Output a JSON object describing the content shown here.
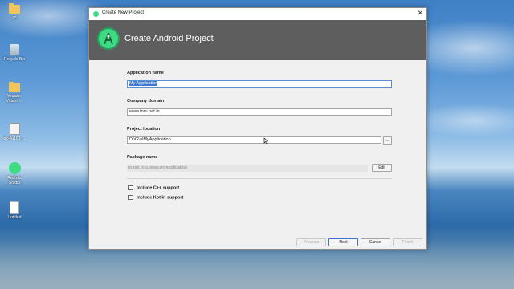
{
  "desktop_icons": [
    {
      "label": "git",
      "icon": "folder-icon"
    },
    {
      "label": "Recycle Bin",
      "icon": "recycle-bin-icon"
    },
    {
      "label": "Youtube Videos ...",
      "icon": "folder-icon"
    },
    {
      "label": "jdk-8u161_...",
      "icon": "java-installer-icon"
    },
    {
      "label": "Android Studio",
      "icon": "android-studio-icon"
    },
    {
      "label": "Untitled",
      "icon": "document-icon"
    }
  ],
  "dialog": {
    "window_title": "Create New Project",
    "close_glyph": "✕",
    "heading": "Create Android Project",
    "accent_color": "#3ddc84",
    "banner_color": "#5e5e5e"
  },
  "form": {
    "application_name": {
      "label": "Application name",
      "value": "My Application"
    },
    "company_domain": {
      "label": "Company domain",
      "value": "www.foru.net.in"
    },
    "project_location": {
      "label": "Project location",
      "value": "D:\\G\\a\\MyApplication",
      "browse_label": "..."
    },
    "package_name": {
      "label": "Package name",
      "value": "in.net.foru.www.myapplication",
      "edit_label": "Edit"
    },
    "include_cpp": {
      "label": "Include C++ support",
      "checked": false
    },
    "include_kotlin": {
      "label": "Include Kotlin support",
      "checked": false
    }
  },
  "footer": {
    "previous": "Previous",
    "next": "Next",
    "cancel": "Cancel",
    "finish": "Finish"
  }
}
